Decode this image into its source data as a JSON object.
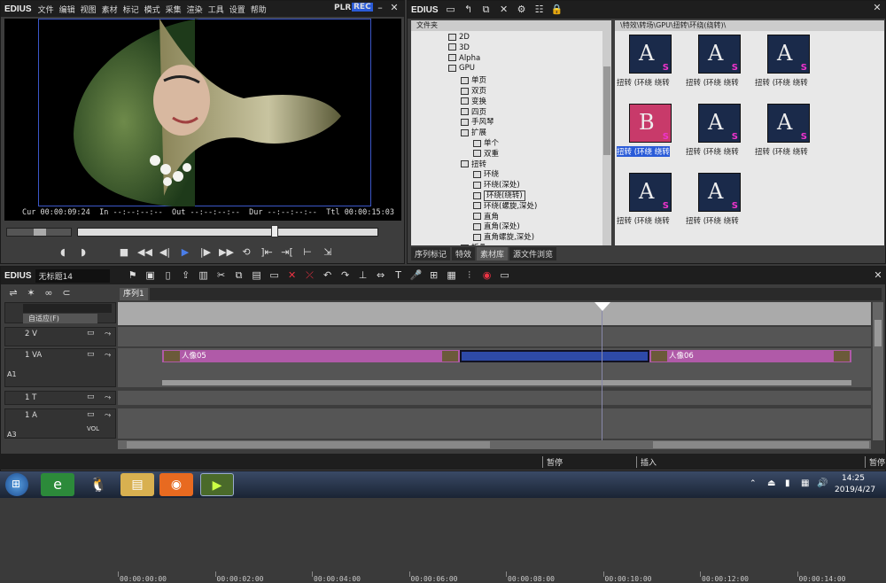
{
  "player": {
    "logo": "EDIUS",
    "menu": [
      "文件",
      "编辑",
      "视图",
      "素材",
      "标记",
      "模式",
      "采集",
      "渲染",
      "工具",
      "设置",
      "帮助"
    ],
    "plr": "PLR",
    "rec": "REC",
    "timecodes": {
      "cur_label": "Cur",
      "cur": "00:00:09:24",
      "in_label": "In",
      "in": "--:--:--:--",
      "out_label": "Out",
      "out": "--:--:--:--",
      "dur_label": "Dur",
      "dur": "--:--:--:--",
      "ttl_label": "Ttl",
      "ttl": "00:00:15:03"
    }
  },
  "library": {
    "logo": "EDIUS",
    "tree_header": "文件夹",
    "path": "\\特效\\转场\\GPU\\扭转\\环绕(绕转)\\",
    "tree": [
      {
        "label": "2D",
        "indent": 0
      },
      {
        "label": "3D",
        "indent": 0
      },
      {
        "label": "Alpha",
        "indent": 0
      },
      {
        "label": "GPU",
        "indent": 0,
        "open": true
      },
      {
        "label": "单页",
        "indent": 1
      },
      {
        "label": "双页",
        "indent": 1
      },
      {
        "label": "变换",
        "indent": 1
      },
      {
        "label": "四页",
        "indent": 1
      },
      {
        "label": "手风琴",
        "indent": 1
      },
      {
        "label": "扩展",
        "indent": 1,
        "open": true
      },
      {
        "label": "单个",
        "indent": 2
      },
      {
        "label": "双重",
        "indent": 2
      },
      {
        "label": "扭转",
        "indent": 1,
        "open": true
      },
      {
        "label": "环绕",
        "indent": 2
      },
      {
        "label": "环绕(深处)",
        "indent": 2
      },
      {
        "label": "环绕(绕转)",
        "indent": 2,
        "selected": true
      },
      {
        "label": "环绕(螺旋,深处)",
        "indent": 2
      },
      {
        "label": "直角",
        "indent": 2
      },
      {
        "label": "直角(深处)",
        "indent": 2
      },
      {
        "label": "直角螺旋,深处)",
        "indent": 2
      },
      {
        "label": "折叠",
        "indent": 1
      }
    ],
    "thumbs": [
      {
        "label": "扭转 (环绕 绕转"
      },
      {
        "label": "扭转 (环绕 绕转"
      },
      {
        "label": "扭转 (环绕 绕转"
      },
      {
        "label": "扭转 (环绕 绕转",
        "selected": true
      },
      {
        "label": "扭转 (环绕 绕转"
      },
      {
        "label": "扭转 (环绕 绕转"
      },
      {
        "label": "扭转 (环绕 绕转"
      },
      {
        "label": "扭转 (环绕 绕转"
      }
    ],
    "tabs": [
      "序列标记",
      "特效",
      "素材库",
      "源文件浏览"
    ]
  },
  "timeline": {
    "logo": "EDIUS",
    "project": "无标题14",
    "sequence_tab": "序列1",
    "fit_label": "自适应(F)",
    "ruler": [
      "00:00:00:00",
      "00:00:02:00",
      "00:00:04:00",
      "00:00:06:00",
      "00:00:08:00",
      "00:00:10:00",
      "00:00:12:00",
      "00:00:14:00"
    ],
    "tracks": [
      {
        "name": "2 V"
      },
      {
        "name": "1 VA",
        "sub": "A1"
      },
      {
        "name": "1 T"
      },
      {
        "name": "1 A",
        "sub": "A3",
        "vol": "VOL"
      }
    ],
    "clips": [
      {
        "label": "人像05"
      },
      {
        "label": "人像06"
      }
    ]
  },
  "status": {
    "left": "暂停",
    "mid": "插入",
    "right": "暂停"
  },
  "taskbar": {
    "time": "14:25",
    "date": "2019/4/27"
  }
}
